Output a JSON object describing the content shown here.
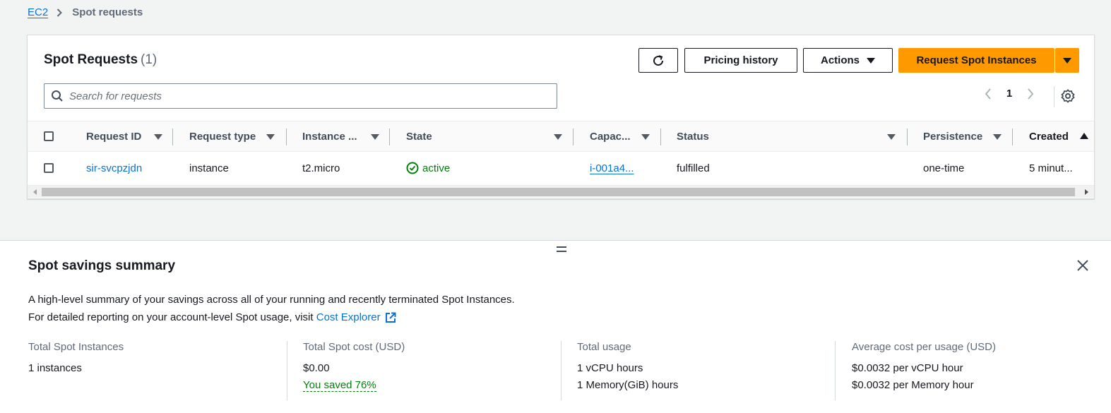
{
  "breadcrumb": {
    "parent": "EC2",
    "current": "Spot requests"
  },
  "header": {
    "title": "Spot Requests",
    "count": "(1)",
    "pricing_label": "Pricing history",
    "actions_label": "Actions",
    "primary_label": "Request Spot Instances"
  },
  "search": {
    "placeholder": "Search for requests",
    "value": ""
  },
  "pagination": {
    "current_page": "1"
  },
  "table": {
    "columns": [
      "Request ID",
      "Request type",
      "Instance ...",
      "State",
      "Capac...",
      "Status",
      "Persistence",
      "Created"
    ],
    "rows": [
      {
        "request_id": "sir-svcpzjdn",
        "request_type": "instance",
        "instance_type": "t2.micro",
        "state": "active",
        "capacity": "i-001a4...",
        "status": "fulfilled",
        "persistence": "one-time",
        "created": "5 minut..."
      }
    ]
  },
  "summary": {
    "title": "Spot savings summary",
    "desc_line1": "A high-level summary of your savings across all of your running and recently terminated Spot Instances.",
    "desc_line2": "For detailed reporting on your account-level Spot usage, visit ",
    "link_label": "Cost Explorer",
    "metrics": {
      "instances_label": "Total Spot Instances",
      "instances_value": "1 instances",
      "cost_label": "Total Spot cost (USD)",
      "cost_value": "$0.00",
      "saved_text": "You saved 76%",
      "usage_label": "Total usage",
      "usage_vcpu": "1 vCPU hours",
      "usage_mem": "1 Memory(GiB) hours",
      "avg_label": "Average cost per usage (USD)",
      "avg_vcpu": "$0.0032 per vCPU hour",
      "avg_mem": "$0.0032 per Memory hour"
    }
  },
  "colors": {
    "accent": "#ff9900",
    "link": "#0972d3",
    "success": "#037f0c"
  },
  "icons": [
    "chevron-right-icon",
    "refresh-icon",
    "caret-down-icon",
    "search-icon",
    "chevron-left-icon",
    "settings-icon",
    "status-success-icon",
    "drag-handle-icon",
    "close-icon",
    "external-link-icon"
  ]
}
